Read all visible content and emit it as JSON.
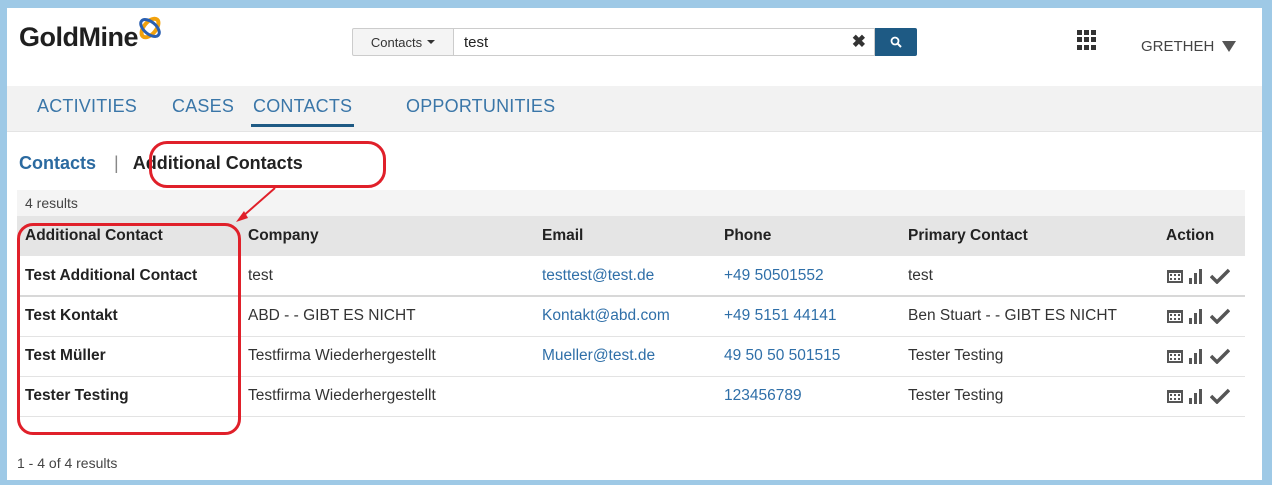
{
  "header": {
    "logo_text": "GoldMine",
    "search_type": "Contacts",
    "search_value": "test",
    "user": "GRETHEH"
  },
  "tabs": [
    {
      "label": "ACTIVITIES",
      "active": false
    },
    {
      "label": "CASES",
      "active": false
    },
    {
      "label": "CONTACTS",
      "active": true
    },
    {
      "label": "OPPORTUNITIES",
      "active": false
    }
  ],
  "subnav": {
    "link": "Contacts",
    "separator": "|",
    "current": "Additional Contacts"
  },
  "results_count": "4 results",
  "table": {
    "columns": [
      "Additional Contact",
      "Company",
      "Email",
      "Phone",
      "Primary Contact",
      "Action"
    ],
    "rows": [
      {
        "name": "Test Additional Contact",
        "company": "test",
        "email": "testtest@test.de",
        "phone": "+49 50501552",
        "primary": "test"
      },
      {
        "name": "Test Kontakt",
        "company": "ABD - - GIBT ES NICHT",
        "email": "Kontakt@abd.com",
        "phone": "+49 5151 44141",
        "primary": "Ben Stuart - - GIBT ES NICHT"
      },
      {
        "name": "Test Müller",
        "company": "Testfirma Wiederhergestellt",
        "email": "Mueller@test.de",
        "phone": "49 50 50 501515",
        "primary": "Tester Testing"
      },
      {
        "name": "Tester Testing",
        "company": "Testfirma Wiederhergestellt",
        "email": "",
        "phone": "123456789",
        "primary": "Tester Testing"
      }
    ]
  },
  "footer": "1 - 4 of 4 results",
  "colors": {
    "accent": "#1e5a84",
    "link": "#2f6fa8",
    "highlight": "#e0202a",
    "frame": "#9ec9e6"
  },
  "icons": [
    "calendar-icon",
    "bar-chart-icon",
    "check-icon",
    "grid-icon",
    "search-icon",
    "clear-icon"
  ]
}
